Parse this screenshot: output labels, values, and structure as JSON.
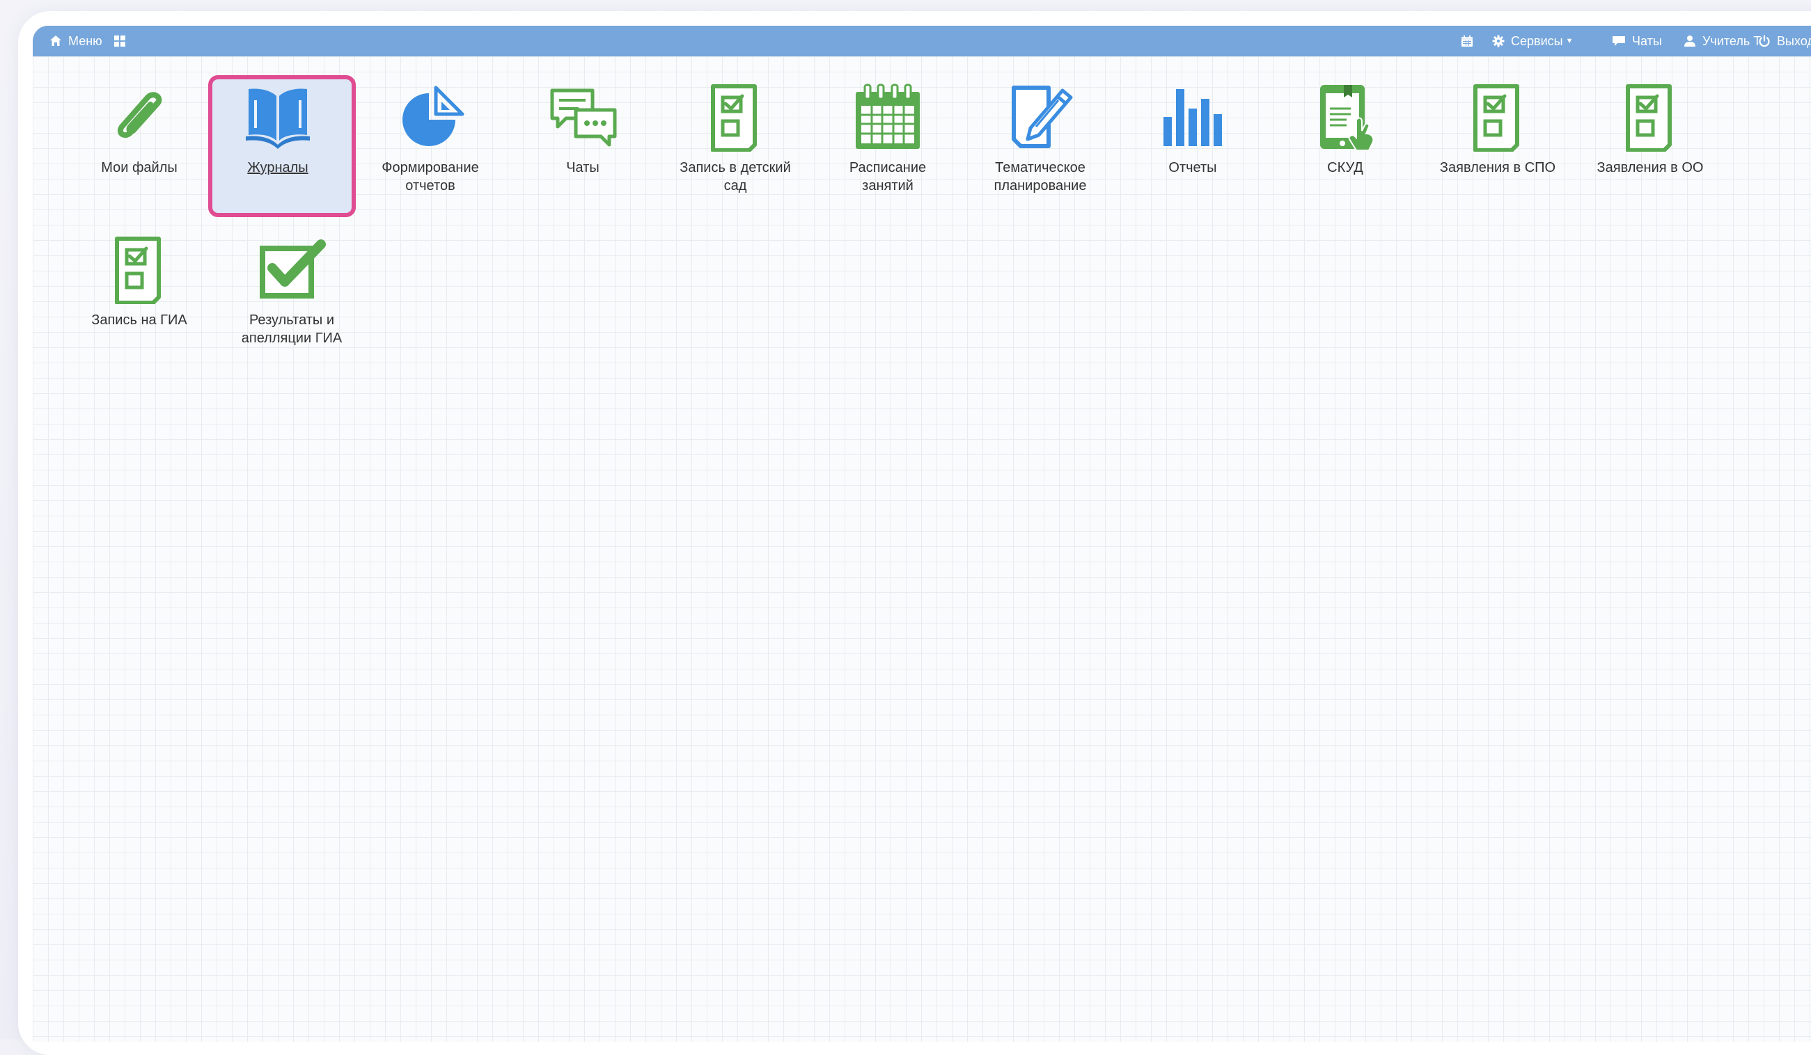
{
  "navbar": {
    "menu_label": "Меню",
    "services_label": "Сервисы",
    "chats_label": "Чаты",
    "user_label": "Учитель Т.",
    "exit_label": "Выход"
  },
  "colors": {
    "navbar": "#76a6db",
    "icon_green": "#5aaa50",
    "icon_blue": "#3a8de0",
    "highlight": "#e04c92"
  },
  "tiles": [
    {
      "label": "Мои файлы",
      "icon": "paperclip-icon"
    },
    {
      "label": "Журналы",
      "icon": "open-book-icon"
    },
    {
      "label": "Формирование\nотчетов",
      "icon": "pie-chart-icon"
    },
    {
      "label": "Чаты",
      "icon": "chat-bubbles-icon"
    },
    {
      "label": "Запись в детский\nсад",
      "icon": "checklist-document-icon"
    },
    {
      "label": "Расписание\nзанятий",
      "icon": "calendar-icon"
    },
    {
      "label": "Тематическое\nпланирование",
      "icon": "document-pen-icon"
    },
    {
      "label": "Отчеты",
      "icon": "bar-chart-icon"
    },
    {
      "label": "СКУД",
      "icon": "access-card-icon"
    },
    {
      "label": "Заявления в СПО",
      "icon": "checklist-document-icon"
    },
    {
      "label": "Заявления в ОО",
      "icon": "checklist-document-icon"
    },
    {
      "label": "Запись на ГИА",
      "icon": "checklist-document-icon"
    },
    {
      "label": "Результаты и\nапелляции ГИА",
      "icon": "checkmark-box-icon"
    }
  ]
}
